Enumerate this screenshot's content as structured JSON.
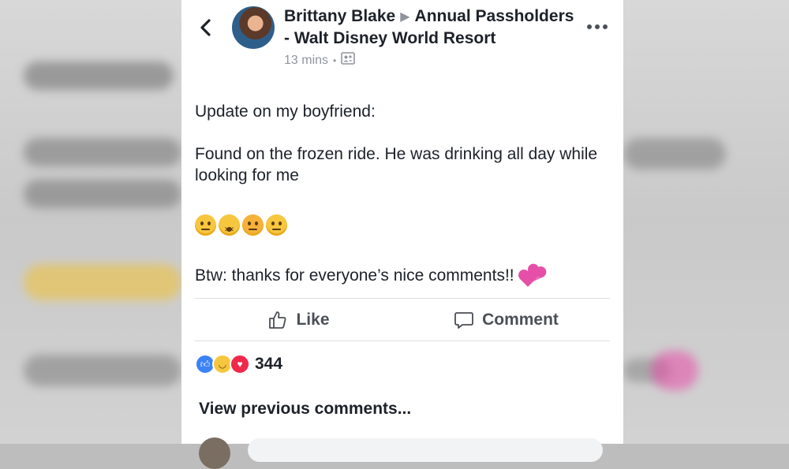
{
  "post": {
    "author": "Brittany Blake",
    "group": "Annual Passholders - Walt Disney World Resort",
    "time": "13 mins",
    "audience_icon": "group-audience-icon",
    "text_line1": "Update on my boyfriend:",
    "text_line2": "Found on the frozen ride. He was drinking all day while looking for me",
    "emojis": [
      "worried-face-icon",
      "dizzy-face-icon",
      "angry-face-icon",
      "unamused-face-icon"
    ],
    "text_line3": "Btw: thanks for everyone’s nice comments!!",
    "hearts_icon": "two-hearts-icon"
  },
  "actions": {
    "like_label": "Like",
    "comment_label": "Comment"
  },
  "reactions": {
    "icons": [
      "like-reaction-icon",
      "haha-reaction-icon",
      "love-reaction-icon"
    ],
    "count": "344"
  },
  "comments": {
    "view_previous_label": "View previous comments..."
  },
  "colors": {
    "text": "#1d2129",
    "muted": "#90949c",
    "action": "#4b4f56",
    "like_blue": "#3b82f6",
    "love_red": "#f02849",
    "heart_pink": "#e64fa7"
  }
}
